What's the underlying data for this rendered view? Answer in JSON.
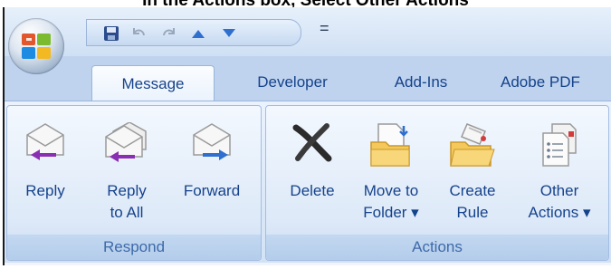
{
  "caption": "In the Actions box, Select Other Actions",
  "tabs": [
    "Message",
    "Developer",
    "Add-Ins",
    "Adobe PDF"
  ],
  "groups": {
    "respond": {
      "label": "Respond",
      "buttons": [
        {
          "line1": "Reply",
          "line2": ""
        },
        {
          "line1": "Reply",
          "line2": "to All"
        },
        {
          "line1": "Forward",
          "line2": ""
        }
      ]
    },
    "actions": {
      "label": "Actions",
      "buttons": [
        {
          "line1": "Delete",
          "line2": ""
        },
        {
          "line1": "Move to",
          "line2": "Folder ▾"
        },
        {
          "line1": "Create",
          "line2": "Rule"
        },
        {
          "line1": "Other",
          "line2": "Actions ▾"
        }
      ]
    }
  },
  "qat": {
    "separator": "="
  },
  "icons": [
    "office-button-icon",
    "save-icon",
    "undo-icon",
    "redo-icon",
    "previous-item-icon",
    "next-item-icon",
    "reply-icon",
    "reply-all-icon",
    "forward-icon",
    "delete-icon",
    "move-to-folder-icon",
    "create-rule-icon",
    "other-actions-icon"
  ]
}
